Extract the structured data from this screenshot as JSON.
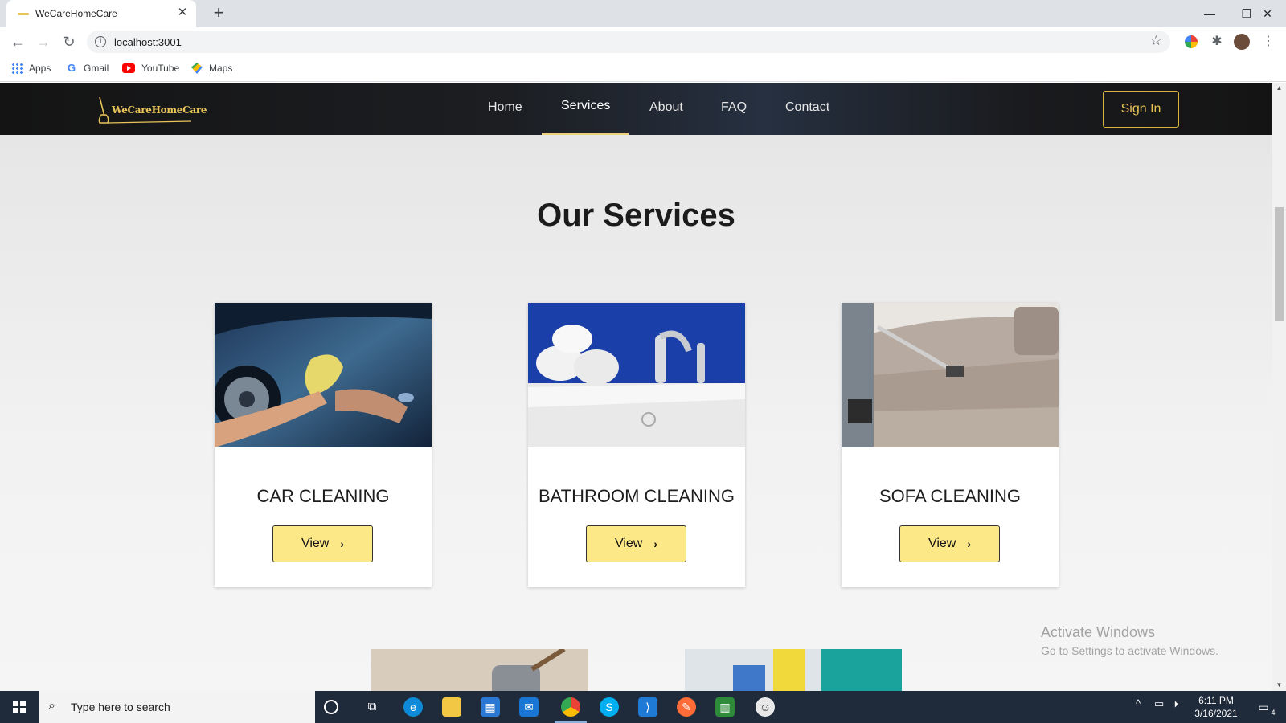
{
  "browser": {
    "tab_title": "WeCareHomeCare",
    "url": "localhost:3001",
    "bookmarks": [
      {
        "label": "Apps",
        "icon": "apps-grid-icon"
      },
      {
        "label": "Gmail",
        "icon": "google-icon"
      },
      {
        "label": "YouTube",
        "icon": "youtube-icon"
      },
      {
        "label": "Maps",
        "icon": "maps-icon"
      }
    ]
  },
  "site": {
    "logo": "WeCareHomeCare",
    "nav": [
      "Home",
      "Services",
      "About",
      "FAQ",
      "Contact"
    ],
    "active_nav": "Services",
    "signin": "Sign In",
    "section_title": "Our Services",
    "services": [
      {
        "name": "CAR CLEANING",
        "button": "View"
      },
      {
        "name": "BATHROOM CLEANING",
        "button": "View"
      },
      {
        "name": "SOFA CLEANING",
        "button": "View"
      }
    ],
    "accent": "#fde888",
    "gold": "#e8c45a"
  },
  "os": {
    "watermark_title": "Activate Windows",
    "watermark_sub": "Go to Settings to activate Windows.",
    "search_placeholder": "Type here to search",
    "time": "6:11 PM",
    "date": "3/16/2021",
    "notifications": "4"
  }
}
